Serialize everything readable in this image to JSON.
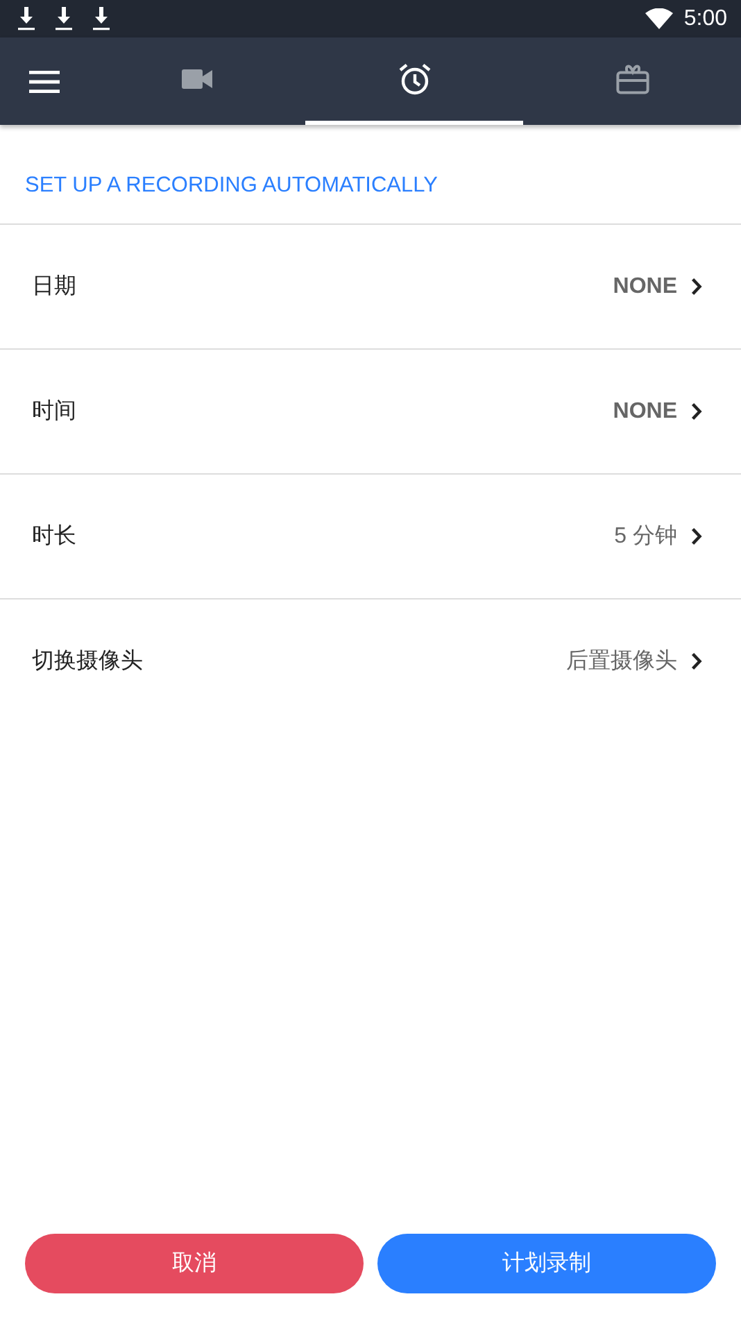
{
  "status_bar": {
    "time": "5:00"
  },
  "tabs": [
    {
      "kind": "video",
      "selected": false
    },
    {
      "kind": "alarm",
      "selected": true
    },
    {
      "kind": "gift",
      "selected": false
    }
  ],
  "section_title": "SET UP A RECORDING AUTOMATICALLY",
  "settings": [
    {
      "label": "日期",
      "value": "NONE"
    },
    {
      "label": "时间",
      "value": "NONE"
    },
    {
      "label": "时长",
      "value": "5 分钟"
    },
    {
      "label": "切换摄像头",
      "value": "后置摄像头"
    }
  ],
  "buttons": [
    {
      "kind": "cancel",
      "label": "取消"
    },
    {
      "kind": "primary",
      "label": "计划录制"
    }
  ]
}
